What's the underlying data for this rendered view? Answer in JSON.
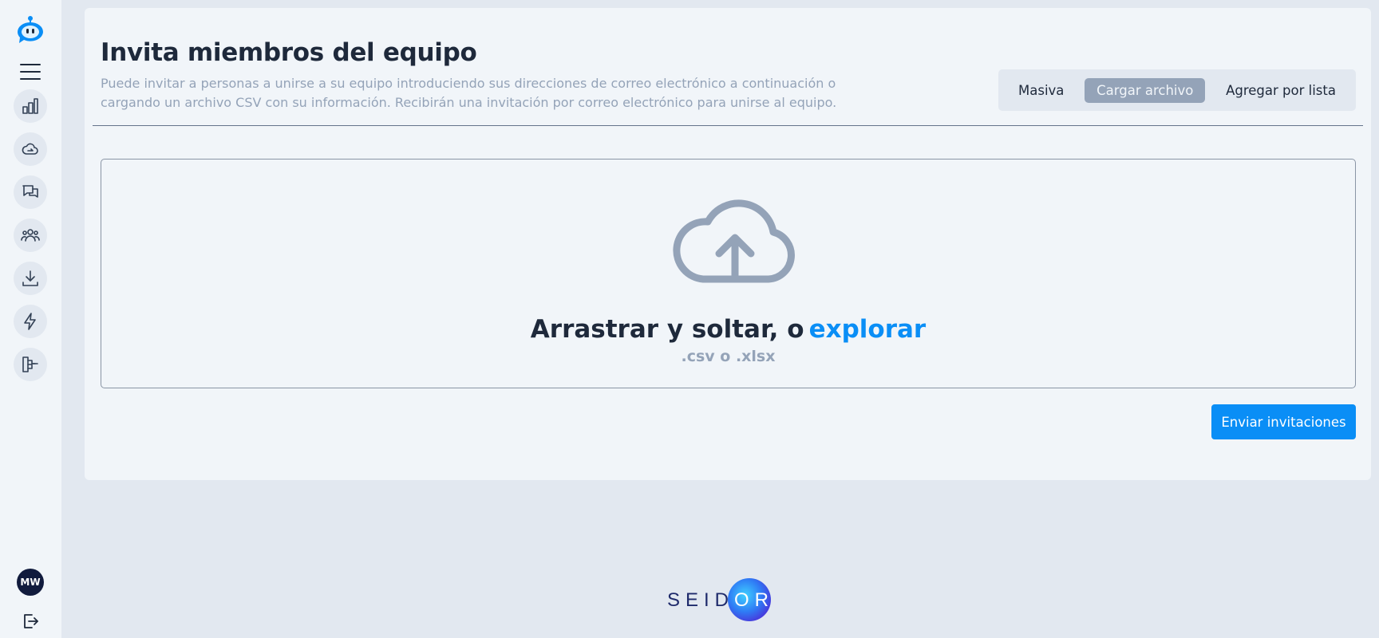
{
  "sidebar": {
    "nav": [
      {
        "icon": "bar-chart-icon",
        "label": ""
      },
      {
        "icon": "cloud-icon",
        "label": ""
      },
      {
        "icon": "chat-icon",
        "label": ""
      },
      {
        "icon": "users-icon",
        "label": ""
      },
      {
        "icon": "download-icon",
        "label": ""
      },
      {
        "icon": "lightning-icon",
        "label": ""
      },
      {
        "icon": "flow-icon",
        "label": ""
      }
    ],
    "avatar_initials": "MW"
  },
  "header": {
    "title": "Invita miembros del equipo",
    "description": "Puede invitar a personas a unirse a su equipo introduciendo sus direcciones de correo electrónico a continuación o cargando un archivo CSV con su información. Recibirán una invitación por correo electrónico para unirse al equipo."
  },
  "tabs": [
    {
      "label": "Masiva",
      "active": false
    },
    {
      "label": "Cargar archivo",
      "active": true
    },
    {
      "label": "Agregar por lista",
      "active": false
    }
  ],
  "dropzone": {
    "prompt": "Arrastrar y soltar, o",
    "browse_label": "explorar",
    "formats": ".csv o .xlsx"
  },
  "actions": {
    "send_label": "Enviar invitaciones"
  },
  "footer": {
    "brand_main": "SEID",
    "brand_accent": "OR"
  },
  "colors": {
    "accent": "#0a8ef6",
    "active_tab": "#94a3b8",
    "avatar_bg": "#111b3d"
  }
}
